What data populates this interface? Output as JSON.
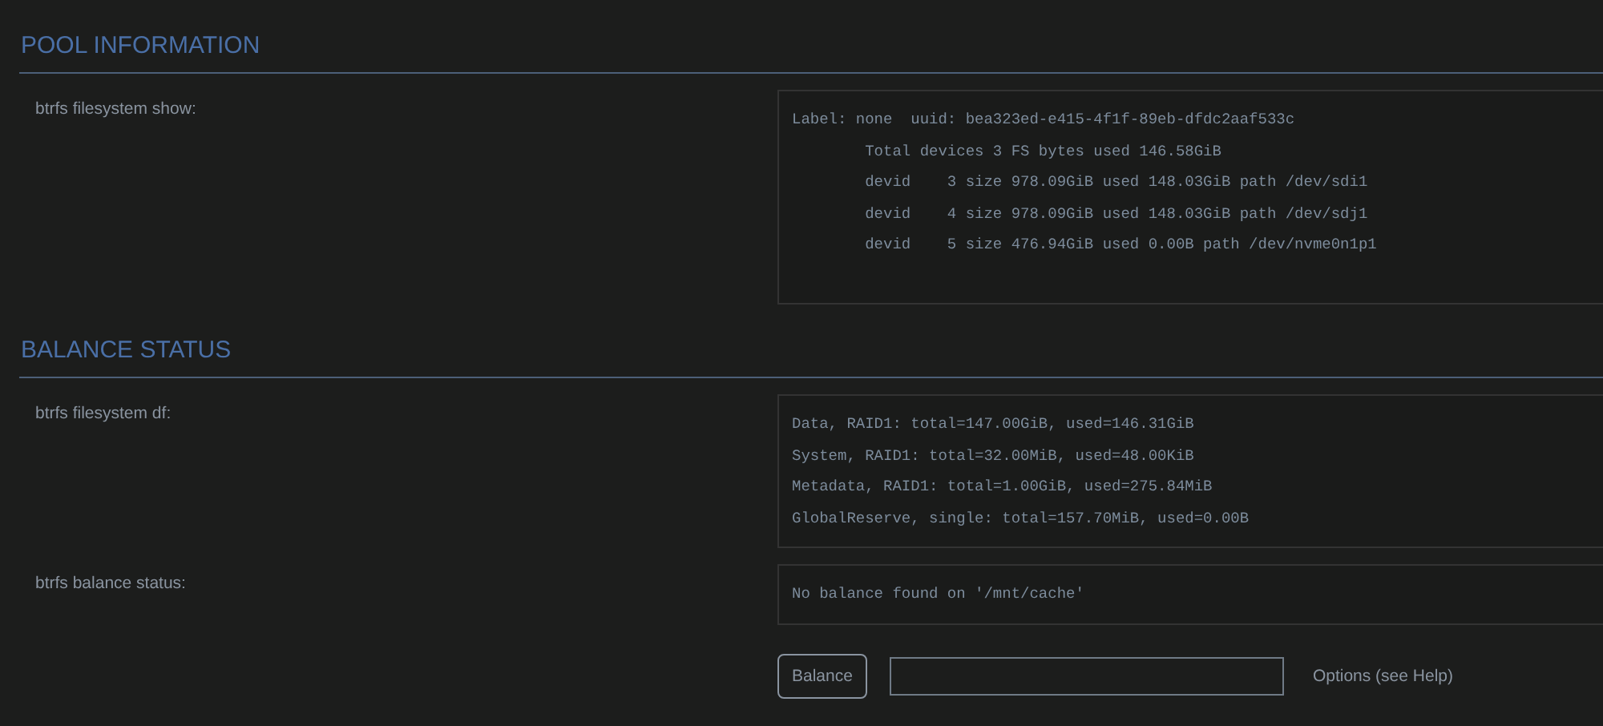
{
  "sections": [
    {
      "title": "POOL INFORMATION",
      "rows": [
        {
          "label": "btrfs filesystem show:",
          "lines": [
            "Label: none  uuid: bea323ed-e415-4f1f-89eb-dfdc2aaf533c",
            "\tTotal devices 3 FS bytes used 146.58GiB",
            "\tdevid    3 size 978.09GiB used 148.03GiB path /dev/sdi1",
            "\tdevid    4 size 978.09GiB used 148.03GiB path /dev/sdj1",
            "\tdevid    5 size 476.94GiB used 0.00B path /dev/nvme0n1p1"
          ]
        }
      ]
    },
    {
      "title": "BALANCE STATUS",
      "rows": [
        {
          "label": "btrfs filesystem df:",
          "lines": [
            "Data, RAID1: total=147.00GiB, used=146.31GiB",
            "System, RAID1: total=32.00MiB, used=48.00KiB",
            "Metadata, RAID1: total=1.00GiB, used=275.84MiB",
            "GlobalReserve, single: total=157.70MiB, used=0.00B"
          ]
        },
        {
          "label": "btrfs balance status:",
          "lines": [
            "No balance found on '/mnt/cache'"
          ]
        }
      ],
      "controls": {
        "button": "Balance",
        "hint": "Options (see Help)"
      }
    }
  ]
}
